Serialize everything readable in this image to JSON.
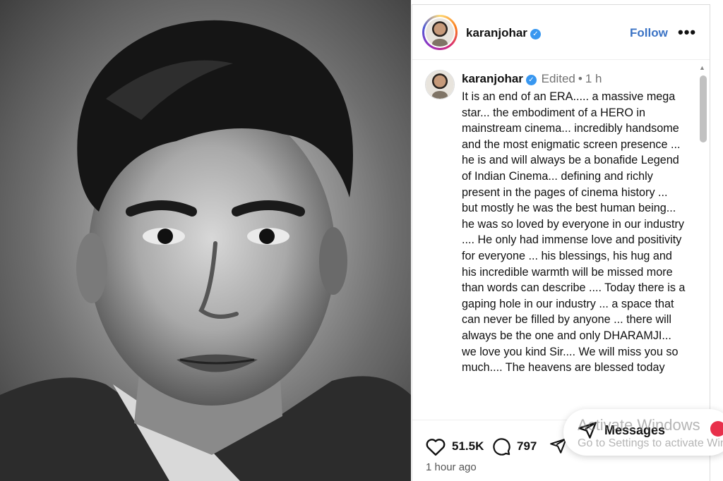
{
  "post": {
    "username": "karanjohar",
    "follow_label": "Follow",
    "more_label": "•••",
    "edited_label": "Edited",
    "separator": "•",
    "time_short": "1 h",
    "caption": "It is an end of an ERA..... a massive mega star... the embodiment of a HERO in mainstream cinema... incredibly handsome and the most  enigmatic screen presence ... he is and will always be a bonafide Legend of Indian Cinema... defining and richly present in the pages of cinema history ... but mostly he was the best human being... he was so loved by everyone in our industry .... He only had immense love and positivity for everyone ... his blessings, his hug and his incredible warmth will be missed more than words can describe .... Today there is a gaping hole in our industry ... a space that can never be filled by anyone ... there will always be the  one and only DHARAMJI... we love you kind Sir.... We will miss you so much.... The heavens are blessed today",
    "likes": "51.5K",
    "comments": "797",
    "timestamp": "1 hour ago"
  },
  "icons": {
    "verified": "verified-badge-icon",
    "like": "heart-icon",
    "comment": "comment-bubble-icon",
    "share": "share-paper-plane-icon",
    "messages": "messages-icon"
  },
  "messages": {
    "label": "Messages"
  },
  "watermark": {
    "line1": "Activate Windows",
    "line2": "Go to Settings to activate Windows."
  },
  "colors": {
    "follow": "#3b73c5",
    "verified": "#3897f0",
    "badge": "#e8304b"
  }
}
